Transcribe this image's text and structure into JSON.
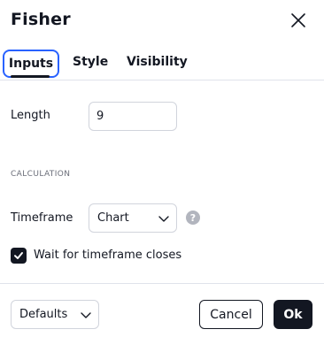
{
  "dialog": {
    "title": "Fisher"
  },
  "tabs": [
    {
      "label": "Inputs",
      "active": true
    },
    {
      "label": "Style",
      "active": false
    },
    {
      "label": "Visibility",
      "active": false
    }
  ],
  "inputs": {
    "length_label": "Length",
    "length_value": "9",
    "section_header": "CALCULATION",
    "timeframe_label": "Timeframe",
    "timeframe_value": "Chart",
    "help_glyph": "?",
    "wait_checkbox_checked": true,
    "wait_checkbox_label": "Wait for timeframe closes"
  },
  "footer": {
    "defaults_label": "Defaults",
    "cancel_label": "Cancel",
    "ok_label": "Ok"
  },
  "icons": {
    "close": "close-icon",
    "chevron": "chevron-down-icon",
    "help": "help-icon",
    "check": "check-icon"
  },
  "colors": {
    "accent": "#2962ff",
    "text": "#131722",
    "border": "#d1d4dc",
    "muted": "#6a6d78"
  }
}
